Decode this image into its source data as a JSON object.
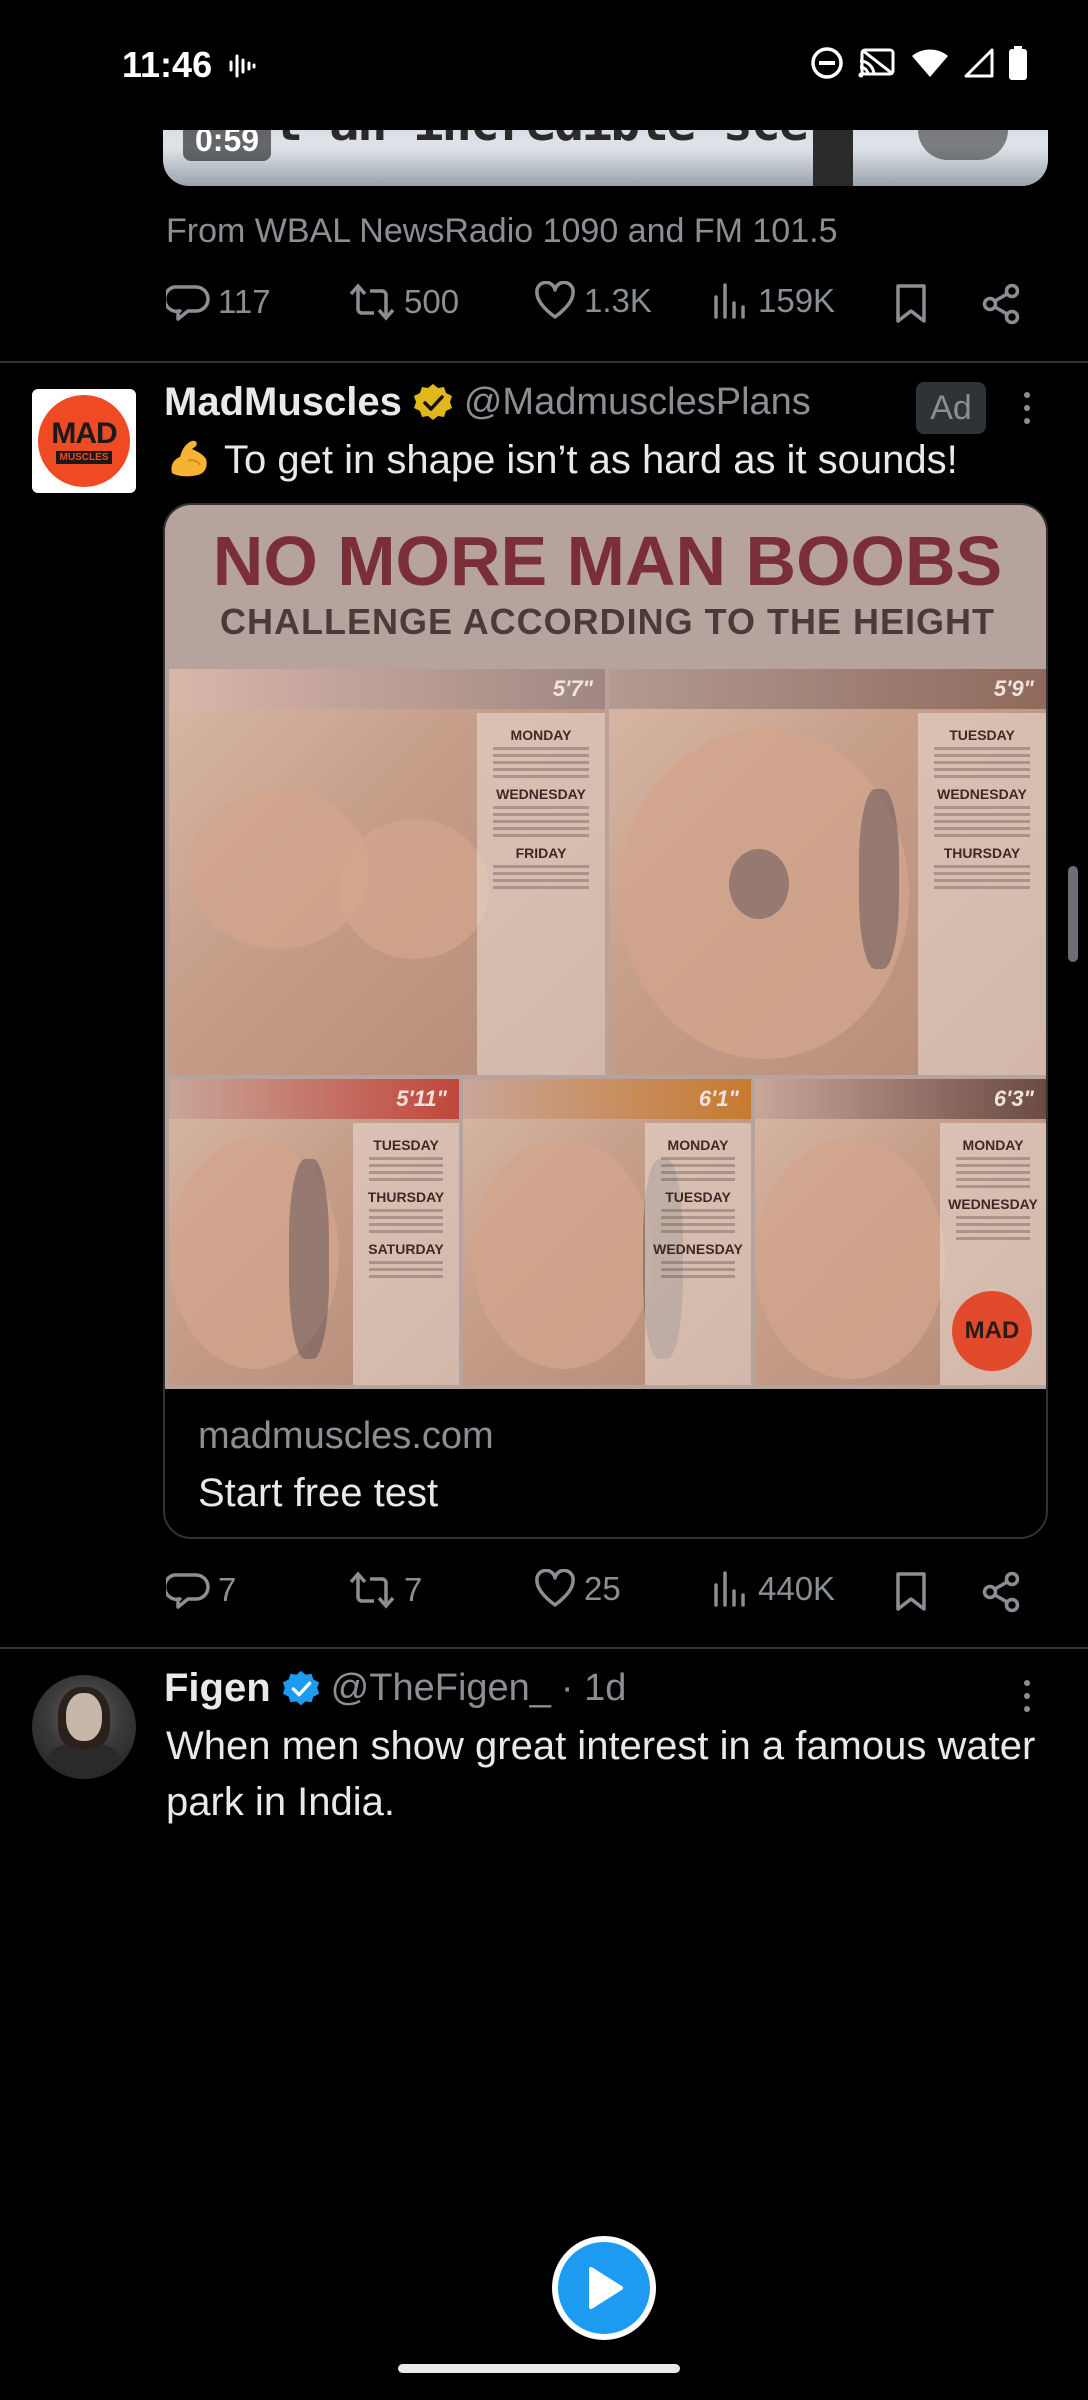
{
  "status_bar": {
    "time": "11:46"
  },
  "prev_tweet": {
    "video_time": "0:59",
    "video_caption_fragment": "t an incredible sce",
    "source": "From WBAL NewsRadio 1090 and FM 101.5",
    "replies": "117",
    "reposts": "500",
    "likes": "1.3K",
    "views": "159K"
  },
  "ad_tweet": {
    "name": "MadMuscles",
    "handle": "@MadmusclesPlans",
    "ad_label": "Ad",
    "text": "To get in shape isn’t as hard as it sounds!",
    "avatar_text_top": "MAD",
    "avatar_text_bottom": "MUSCLES",
    "card": {
      "headline": "NO MORE MAN BOOBS",
      "subheadline": "CHALLENGE ACCORDING TO THE HEIGHT",
      "heights": [
        "5'7\"",
        "5'9\"",
        "5'11\"",
        "6'1\"",
        "6'3\""
      ],
      "days": {
        "p1": [
          "MONDAY",
          "WEDNESDAY",
          "FRIDAY"
        ],
        "p2": [
          "TUESDAY",
          "WEDNESDAY",
          "THURSDAY"
        ],
        "p3": [
          "TUESDAY",
          "THURSDAY",
          "SATURDAY"
        ],
        "p4": [
          "MONDAY",
          "TUESDAY",
          "WEDNESDAY"
        ],
        "p5": [
          "MONDAY",
          "WEDNESDAY"
        ]
      },
      "seal": "MAD",
      "domain": "madmuscles.com",
      "cta": "Start free test"
    },
    "replies": "7",
    "reposts": "7",
    "likes": "25",
    "views": "440K"
  },
  "figen_tweet": {
    "name": "Figen",
    "handle": "@TheFigen_",
    "time": "· 1d",
    "text": "When men show great interest in a famous water park in India."
  },
  "colors": {
    "background": "#000000",
    "text_primary": "#e7e9ea",
    "text_secondary": "#8b8f94",
    "verified_gold": "#e2b719",
    "verified_blue": "#1d9bf0",
    "brand_orange": "#ef4a23"
  },
  "icons": {
    "reply": "reply-icon",
    "repost": "repost-icon",
    "like": "heart-icon",
    "views": "views-icon",
    "bookmark": "bookmark-icon",
    "share": "share-icon"
  }
}
